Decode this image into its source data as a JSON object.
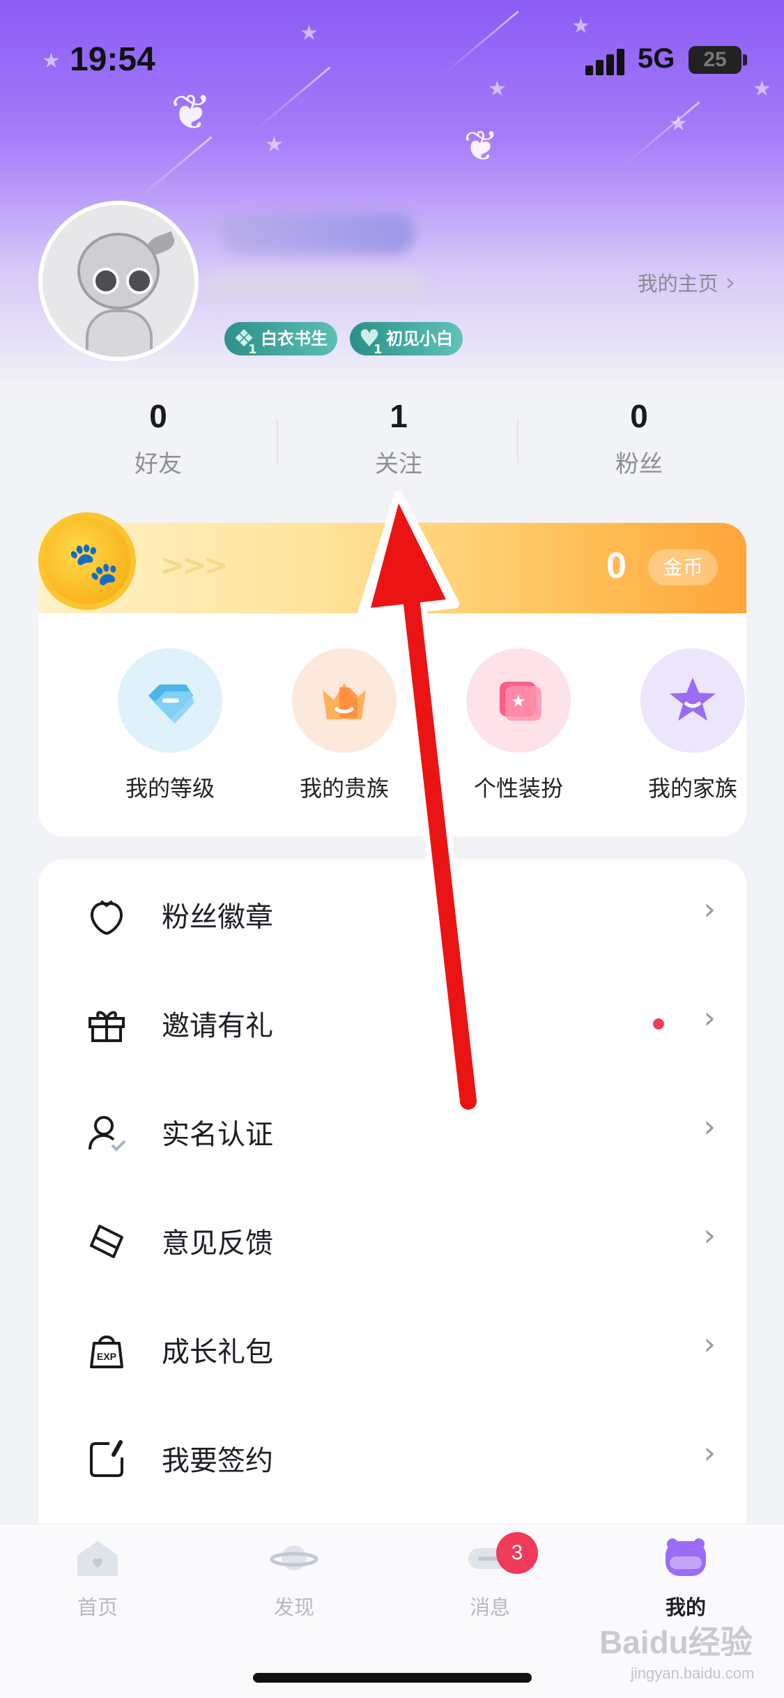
{
  "status_bar": {
    "time": "19:54",
    "network": "5G",
    "battery": "25"
  },
  "profile": {
    "home_link": "我的主页",
    "badges": [
      {
        "label": "白衣书生",
        "level": "1"
      },
      {
        "label": "初见小白",
        "level": "1"
      }
    ]
  },
  "stats": [
    {
      "value": "0",
      "label": "好友"
    },
    {
      "value": "1",
      "label": "关注"
    },
    {
      "value": "0",
      "label": "粉丝"
    }
  ],
  "coins": {
    "arrows": ">>>",
    "amount": "0",
    "unit": "金币"
  },
  "features": [
    {
      "label": "我的等级",
      "icon": "diamond-ticket-icon"
    },
    {
      "label": "我的贵族",
      "icon": "crown-icon"
    },
    {
      "label": "个性装扮",
      "icon": "card-icon"
    },
    {
      "label": "我的家族",
      "icon": "star-icon"
    }
  ],
  "menu": [
    {
      "label": "粉丝徽章",
      "icon": "strawberry-badge-icon",
      "has_dot": false
    },
    {
      "label": "邀请有礼",
      "icon": "gift-icon",
      "has_dot": true
    },
    {
      "label": "实名认证",
      "icon": "user-verify-icon",
      "has_dot": false
    },
    {
      "label": "意见反馈",
      "icon": "eraser-feedback-icon",
      "has_dot": false
    },
    {
      "label": "成长礼包",
      "icon": "exp-bag-icon",
      "has_dot": false
    },
    {
      "label": "我要签约",
      "icon": "sign-contract-icon",
      "has_dot": false
    }
  ],
  "tabs": [
    {
      "label": "首页",
      "icon": "home-icon",
      "active": false
    },
    {
      "label": "发现",
      "icon": "planet-icon",
      "active": false
    },
    {
      "label": "消息",
      "icon": "message-icon",
      "active": false,
      "badge": "3"
    },
    {
      "label": "我的",
      "icon": "profile-face-icon",
      "active": true
    }
  ],
  "watermark": {
    "brand": "Baidu经验",
    "site": "jingyan.baidu.com"
  },
  "colors": {
    "accent_purple": "#8b5cf6",
    "coin_orange": "#ffa53a",
    "badge_red": "#f03a5a"
  }
}
